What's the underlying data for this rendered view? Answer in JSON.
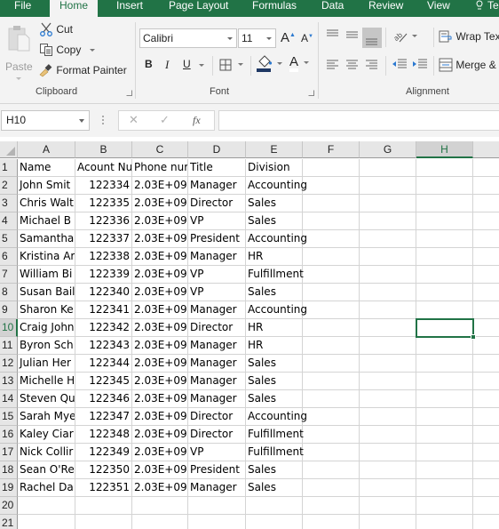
{
  "app": {
    "accent_color": "#217346"
  },
  "tabs": [
    {
      "label": "File",
      "active": false
    },
    {
      "label": "Home",
      "active": true
    },
    {
      "label": "Insert",
      "active": false
    },
    {
      "label": "Page Layout",
      "active": false
    },
    {
      "label": "Formulas",
      "active": false
    },
    {
      "label": "Data",
      "active": false
    },
    {
      "label": "Review",
      "active": false
    },
    {
      "label": "View",
      "active": false
    },
    {
      "label": "Te",
      "active": false,
      "icon": "lightbulb-icon"
    }
  ],
  "ribbon": {
    "clipboard": {
      "label": "Clipboard",
      "paste": "Paste",
      "cut": "Cut",
      "copy": "Copy",
      "format_painter": "Format Painter"
    },
    "font": {
      "label": "Font",
      "font_name": "Calibri",
      "font_size": "11",
      "grow": "A",
      "shrink": "A",
      "bold": "B",
      "italic": "I",
      "underline": "U",
      "fill_color": "#1f3864",
      "font_color_letter": "A"
    },
    "alignment": {
      "label": "Alignment",
      "wrap_text": "Wrap Tex",
      "merge": "Merge &"
    }
  },
  "formula_bar": {
    "name_box": "H10",
    "cancel": "✕",
    "enter": "✓",
    "fx": "fx",
    "value": ""
  },
  "sheet": {
    "columns": [
      "A",
      "B",
      "C",
      "D",
      "E",
      "F",
      "G",
      "H"
    ],
    "selected_column": "H",
    "selected_row": 10,
    "selected_cell": "H10",
    "row_numbers": [
      "1",
      "2",
      "3",
      "4",
      "5",
      "6",
      "7",
      "8",
      "9",
      "10",
      "11",
      "12",
      "13",
      "14",
      "15",
      "16",
      "17",
      "18",
      "19",
      "20",
      "21"
    ],
    "rows": [
      [
        "Name",
        "Acount Nu",
        "Phone nur",
        "Title",
        "Division"
      ],
      [
        "John Smit",
        "122334",
        "2.03E+09",
        "Manager",
        "Accounting"
      ],
      [
        "Chris Walt",
        "122335",
        "2.03E+09",
        "Director",
        "Sales"
      ],
      [
        "Michael B",
        "122336",
        "2.03E+09",
        "VP",
        "Sales"
      ],
      [
        "Samantha",
        "122337",
        "2.03E+09",
        "President",
        "Accounting"
      ],
      [
        "Kristina Ar",
        "122338",
        "2.03E+09",
        "Manager",
        "HR"
      ],
      [
        "William Bi",
        "122339",
        "2.03E+09",
        "VP",
        "Fulfillment"
      ],
      [
        "Susan Bail",
        "122340",
        "2.03E+09",
        "VP",
        "Sales"
      ],
      [
        "Sharon Ke",
        "122341",
        "2.03E+09",
        "Manager",
        "Accounting"
      ],
      [
        "Craig John",
        "122342",
        "2.03E+09",
        "Director",
        "HR"
      ],
      [
        "Byron Sch",
        "122343",
        "2.03E+09",
        "Manager",
        "HR"
      ],
      [
        "Julian Her",
        "122344",
        "2.03E+09",
        "Manager",
        "Sales"
      ],
      [
        "Michelle H",
        "122345",
        "2.03E+09",
        "Manager",
        "Sales"
      ],
      [
        "Steven Qu",
        "122346",
        "2.03E+09",
        "Manager",
        "Sales"
      ],
      [
        "Sarah Mye",
        "122347",
        "2.03E+09",
        "Director",
        "Accounting"
      ],
      [
        "Kaley Ciar",
        "122348",
        "2.03E+09",
        "Director",
        "Fulfillment"
      ],
      [
        "Nick Collir",
        "122349",
        "2.03E+09",
        "VP",
        "Fulfillment"
      ],
      [
        "Sean O'Re",
        "122350",
        "2.03E+09",
        "President",
        "Sales"
      ],
      [
        "Rachel Da",
        "122351",
        "2.03E+09",
        "Manager",
        "Sales"
      ],
      [
        "",
        "",
        "",
        "",
        ""
      ],
      [
        "",
        "",
        "",
        "",
        ""
      ]
    ]
  }
}
